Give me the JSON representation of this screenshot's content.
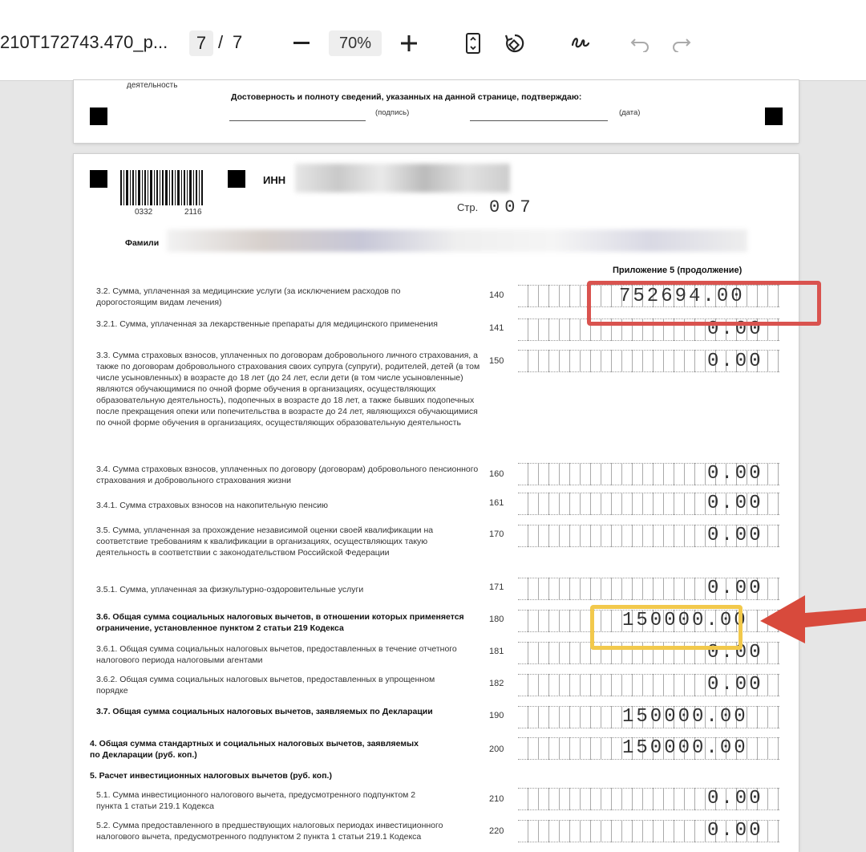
{
  "toolbar": {
    "filename": "210T172743.470_p...",
    "page_current": "7",
    "page_separator": "/",
    "page_total": "7",
    "zoom": "70%",
    "icons": [
      "zoom-out-icon",
      "zoom-in-icon",
      "fit-page-icon",
      "rotate-icon",
      "draw-icon",
      "undo-icon",
      "redo-icon"
    ]
  },
  "prev_page": {
    "activity_text": "деятельность",
    "confirm_text": "Достоверность и полноту сведений, указанных на данной странице, подтверждаю:",
    "signature_label": "(подпись)",
    "date_label": "(дата)"
  },
  "page": {
    "barcode_code_1": "0332",
    "barcode_code_2": "2116",
    "inn_label": "ИНН",
    "page_label": "Стр.",
    "page_number": "007",
    "surname_label": "Фамили",
    "appendix_title": "Приложение 5 (продолжение)",
    "rows": [
      {
        "text": "3.2. Сумма, уплаченная за медицинские услуги (за исключением расходов по дорогостоящим видам лечения)",
        "code": "140",
        "value": "752694.00"
      },
      {
        "text": "3.2.1. Сумма, уплаченная за лекарственные препараты для медицинского применения",
        "code": "141",
        "value": "0.00"
      },
      {
        "text": "3.3. Сумма страховых взносов, уплаченных по договорам добровольного личного страхования, а также по договорам добровольного страхования своих супруга (супруги), родителей, детей (в том числе усыновленных) в возрасте до 18 лет (до 24 лет, если дети (в том числе усыновленные) являются обучающимися по очной форме обучения в организациях, осуществляющих образовательную деятельность), подопечных в возрасте до 18 лет, а также бывших подопечных после прекращения опеки или попечительства в возрасте до 24 лет, являющихся обучающимися по очной форме обучения в организациях, осуществляющих образовательную деятельность",
        "code": "150",
        "value": "0.00"
      },
      {
        "text": "3.4. Сумма страховых взносов, уплаченных по договору (договорам) добровольного пенсионного страхования и добровольного страхования жизни",
        "code": "160",
        "value": "0.00"
      },
      {
        "text": "3.4.1. Сумма страховых взносов на накопительную пенсию",
        "code": "161",
        "value": "0.00"
      },
      {
        "text": "3.5. Сумма, уплаченная за прохождение независимой оценки своей квалификации на соответствие требованиям к квалификации в организациях, осуществляющих такую деятельность в соответствии с законодательством Российской Федерации",
        "code": "170",
        "value": "0.00"
      },
      {
        "text": "3.5.1. Сумма, уплаченная за физкультурно-оздоровительные услуги",
        "code": "171",
        "value": "0.00"
      },
      {
        "text": "3.6. Общая сумма социальных налоговых вычетов, в отношении которых применяется ограничение, установленное пунктом 2 статьи 219 Кодекса",
        "code": "180",
        "value": "150000.00"
      },
      {
        "text": "3.6.1. Общая сумма социальных налоговых вычетов, предоставленных в течение отчетного налогового периода налоговыми агентами",
        "code": "181",
        "value": "0.00"
      },
      {
        "text": "3.6.2. Общая сумма социальных налоговых вычетов, предоставленных в упрощенном порядке",
        "code": "182",
        "value": "0.00"
      },
      {
        "text": "3.7. Общая сумма социальных налоговых вычетов, заявляемых по Декларации",
        "code": "190",
        "value": "150000.00"
      },
      {
        "text": "4. Общая сумма стандартных и социальных налоговых вычетов, заявляемых по Декларации (руб. коп.)",
        "code": "200",
        "value": "150000.00"
      },
      {
        "text": "5. Расчет инвестиционных налоговых вычетов (руб. коп.)",
        "code": "",
        "value": ""
      },
      {
        "text": "5.1. Сумма инвестиционного налогового вычета, предусмотренного подпунктом 2 пункта 1 статьи 219.1 Кодекса",
        "code": "210",
        "value": "0.00"
      },
      {
        "text": "5.2. Сумма предоставленного в предшествующих налоговых периодах инвестиционного налогового вычета, предусмотренного подпунктом 2 пункта 1 статьи 219.1 Кодекса",
        "code": "220",
        "value": "0.00"
      }
    ]
  },
  "annotations": {
    "red_box_color": "#d9534f",
    "yellow_box_color": "#f2c94c",
    "arrow_color": "#d84a3c"
  }
}
